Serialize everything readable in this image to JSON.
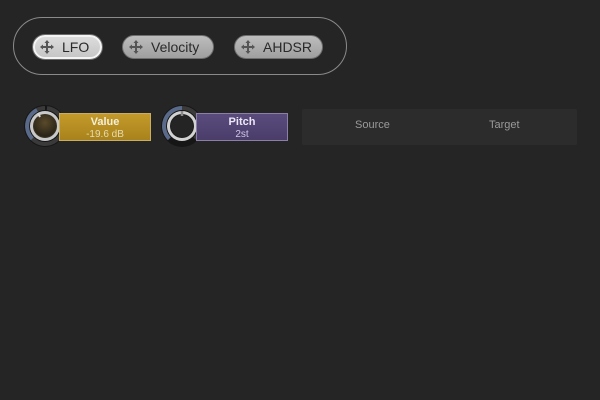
{
  "mod_sources": [
    {
      "label": "LFO",
      "active": true,
      "icon": "move-icon"
    },
    {
      "label": "Velocity",
      "active": false,
      "icon": "move-icon"
    },
    {
      "label": "AHDSR",
      "active": false,
      "icon": "move-icon"
    }
  ],
  "controls": {
    "value": {
      "name": "Value",
      "readout": "-19.6 dB",
      "color": "#b48f24"
    },
    "pitch": {
      "name": "Pitch",
      "readout": "2st",
      "color": "#524473"
    }
  },
  "routing": {
    "source_label": "Source",
    "target_label": "Target"
  }
}
